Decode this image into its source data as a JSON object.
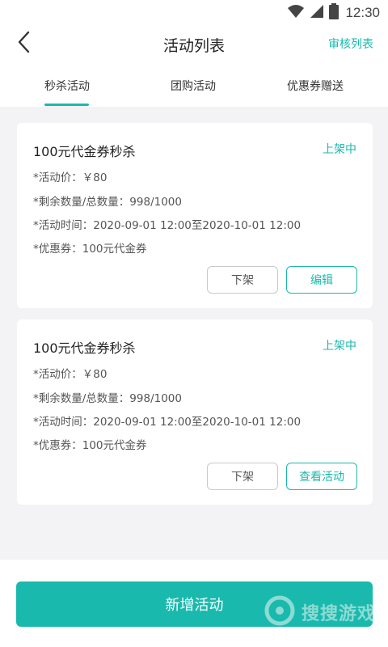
{
  "status_bar": {
    "time": "12:30"
  },
  "header": {
    "title": "活动列表",
    "audit_link": "审核列表"
  },
  "tabs": [
    {
      "label": "秒杀活动",
      "active": true
    },
    {
      "label": "团购活动",
      "active": false
    },
    {
      "label": "优惠券赠送",
      "active": false
    }
  ],
  "cards": [
    {
      "title": "100元代金券秒杀",
      "status": "上架中",
      "price_line": "*活动价：￥80",
      "quantity_line": "*剩余数量/总数量：998/1000",
      "time_line": "*活动时间：2020-09-01 12:00至2020-10-01 12:00",
      "coupon_line": "*优惠券：100元代金券",
      "button_left": "下架",
      "button_right": "编辑"
    },
    {
      "title": "100元代金券秒杀",
      "status": "上架中",
      "price_line": "*活动价：￥80",
      "quantity_line": "*剩余数量/总数量：998/1000",
      "time_line": "*活动时间：2020-09-01 12:00至2020-10-01 12:00",
      "coupon_line": "*优惠券：100元代金券",
      "button_left": "下架",
      "button_right": "查看活动"
    }
  ],
  "bottom": {
    "add_button": "新增活动"
  },
  "watermark": {
    "text": "搜搜游戏"
  },
  "colors": {
    "accent": "#1ab9ad",
    "background": "#f3f3f6"
  },
  "icons": {
    "back": "chevron-left-icon",
    "wifi": "wifi-icon",
    "signal": "signal-icon",
    "battery": "battery-icon"
  }
}
